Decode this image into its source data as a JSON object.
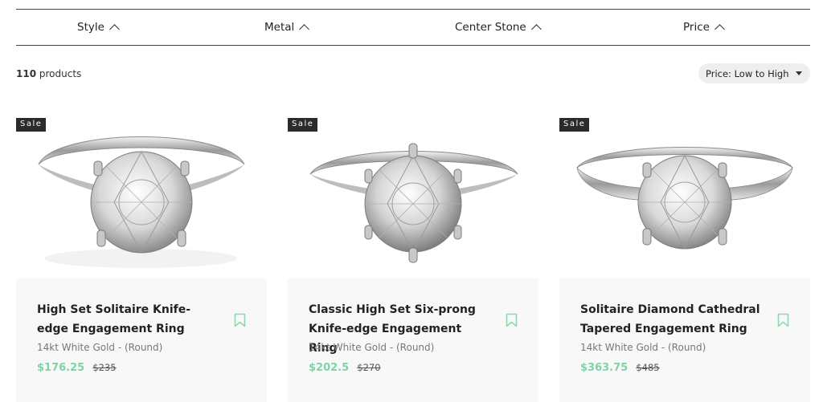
{
  "filters": [
    {
      "label": "Style"
    },
    {
      "label": "Metal"
    },
    {
      "label": "Center Stone"
    },
    {
      "label": "Price"
    }
  ],
  "results": {
    "count_number": "110",
    "count_word": "products"
  },
  "sort": {
    "label": "Price: Low to High"
  },
  "products": [
    {
      "badge": "Sale",
      "name": "High Set Solitaire Knife-edge Engagement Ring",
      "metal": "14kt White Gold - (Round)",
      "sale_price": "$176.25",
      "original_price": "$235",
      "image": "ring-4-prong-icon"
    },
    {
      "badge": "Sale",
      "name": "Classic High Set Six-prong Knife-edge Engagement Ring",
      "metal": "14kt White Gold - (Round)",
      "sale_price": "$202.5",
      "original_price": "$270",
      "image": "ring-6-prong-icon"
    },
    {
      "badge": "Sale",
      "name": "Solitaire Diamond Cathedral Tapered Engagement Ring",
      "metal": "14kt White Gold - (Round)",
      "sale_price": "$363.75",
      "original_price": "$485",
      "image": "ring-cathedral-icon"
    }
  ],
  "colors": {
    "sale_price": "#7fd3a4",
    "badge_bg": "#2b2b2b",
    "card_bg": "#f8f8f8",
    "bookmark": "#8fd9ad"
  }
}
